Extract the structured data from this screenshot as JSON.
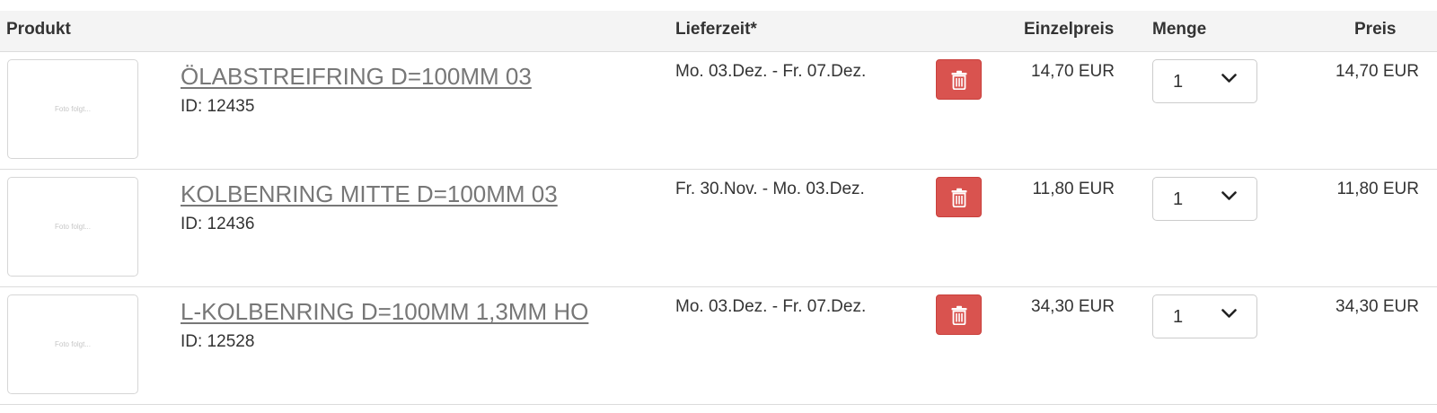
{
  "header": {
    "product": "Produkt",
    "delivery": "Lieferzeit*",
    "unit_price": "Einzelpreis",
    "quantity": "Menge",
    "price": "Preis"
  },
  "rows": [
    {
      "thumb_text": "Foto folgt...",
      "name": "ÖLABSTREIFRING D=100MM 03",
      "id": "ID: 12435",
      "delivery": "Mo. 03.Dez. - Fr. 07.Dez.",
      "unit_price": "14,70 EUR",
      "quantity": "1",
      "price": "14,70 EUR"
    },
    {
      "thumb_text": "Foto folgt...",
      "name": "KOLBENRING MITTE D=100MM 03",
      "id": "ID: 12436",
      "delivery": "Fr. 30.Nov. - Mo. 03.Dez.",
      "unit_price": "11,80 EUR",
      "quantity": "1",
      "price": "11,80 EUR"
    },
    {
      "thumb_text": "Foto folgt...",
      "name": "L-KOLBENRING D=100MM 1,3MM HO",
      "id": "ID: 12528",
      "delivery": "Mo. 03.Dez. - Fr. 07.Dez.",
      "unit_price": "34,30 EUR",
      "quantity": "1",
      "price": "34,30 EUR"
    }
  ],
  "icons": {
    "delete": "trash-icon",
    "quantity_dropdown": "chevron-down-icon"
  },
  "colors": {
    "delete_button": "#d9534f",
    "header_background": "#f4f4f4",
    "product_link": "#777777"
  }
}
